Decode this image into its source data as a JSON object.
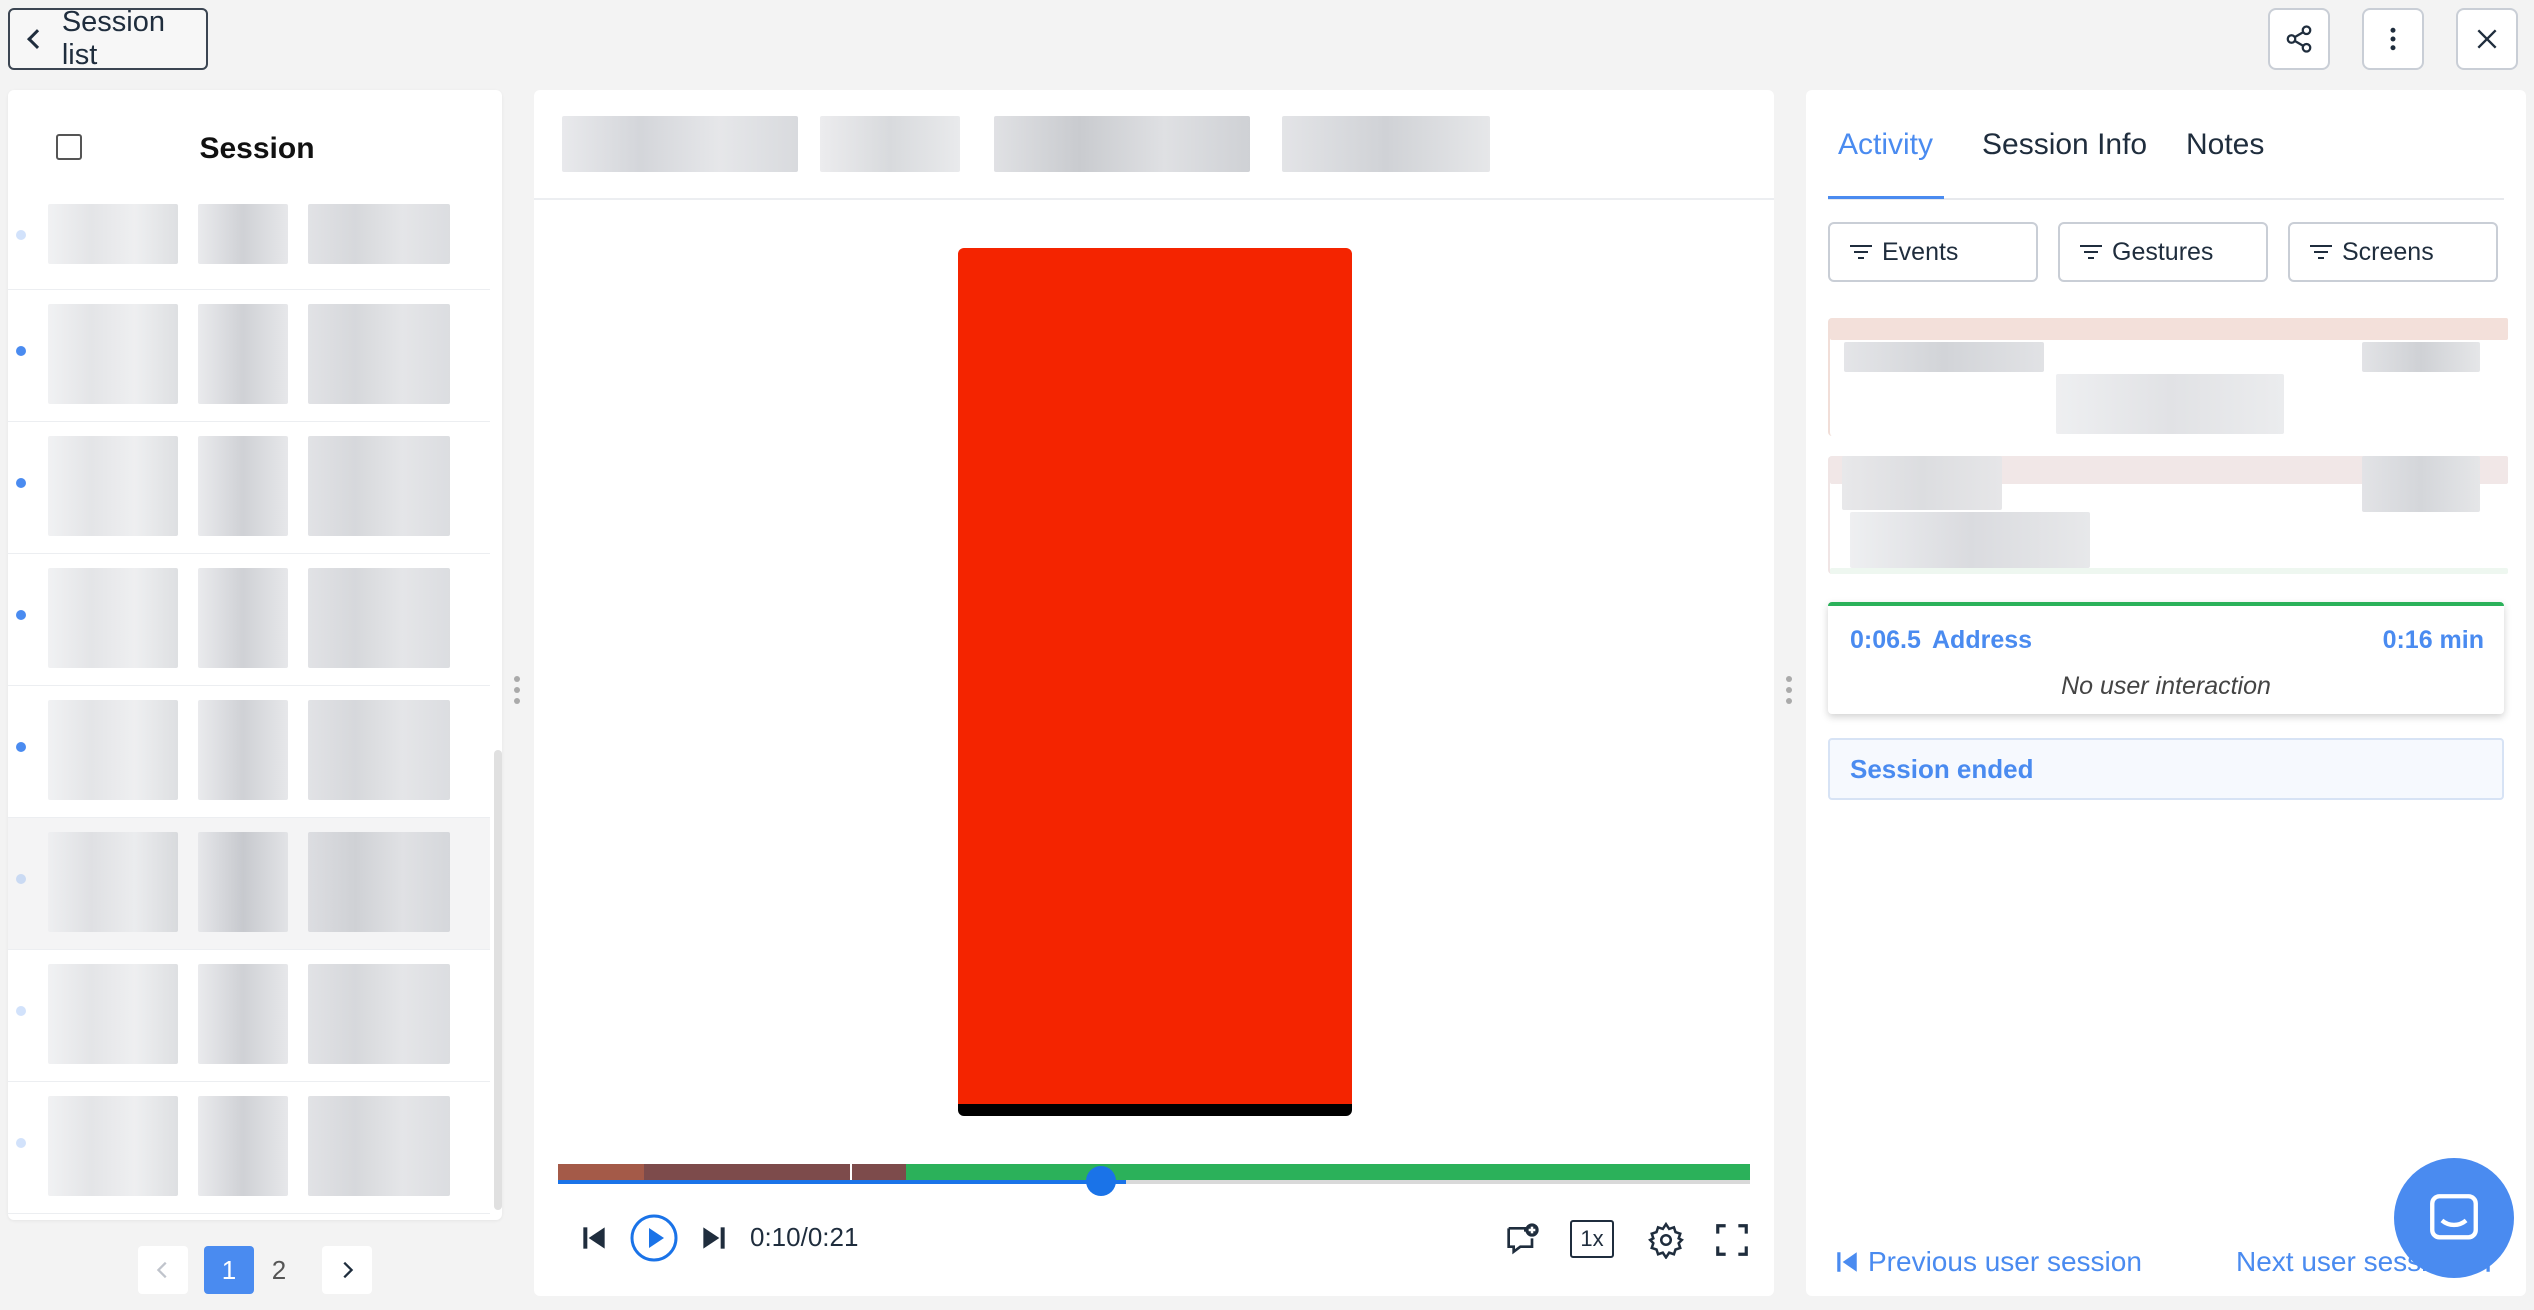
{
  "header": {
    "back_label": "Session list",
    "icons": [
      "share-icon",
      "more-vertical-icon",
      "close-icon"
    ]
  },
  "left_panel": {
    "column_title": "Session",
    "pagination": {
      "pages": [
        "1",
        "2"
      ],
      "current": "1"
    }
  },
  "player": {
    "time": "0:10/0:21",
    "speed": "1x",
    "progress": 0.476,
    "colors": {
      "accent": "#1a73e8",
      "screen": "#f42400",
      "timeline_green": "#2bb15a",
      "timeline_red": "#a45a48",
      "timeline_brown": "#7d4b4b"
    }
  },
  "right_panel": {
    "tabs": [
      "Activity",
      "Session Info",
      "Notes"
    ],
    "active_tab": "Activity",
    "filters": [
      "Events",
      "Gestures",
      "Screens"
    ],
    "screen_event": {
      "time": "0:06.5",
      "name": "Address",
      "duration": "0:16 min",
      "detail": "No user interaction"
    },
    "session_ended": "Session ended",
    "prev_session": "Previous user session",
    "next_session": "Next user session"
  }
}
